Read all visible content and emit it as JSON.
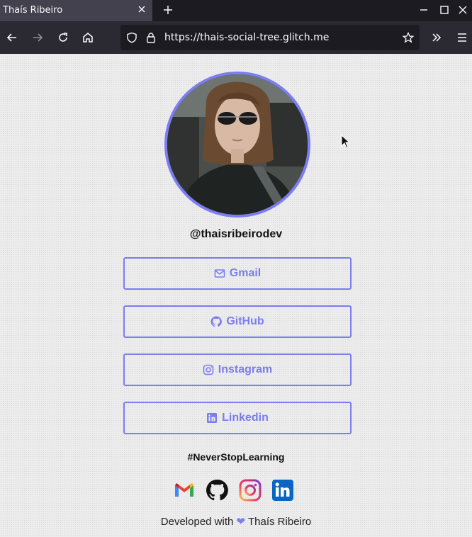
{
  "browser": {
    "tab_title": "Thaís Ribeiro",
    "url_text": "https://thais-social-tree.glitch.me"
  },
  "profile": {
    "username": "@thaisribeirodev"
  },
  "links": [
    {
      "label": "Gmail",
      "icon": "envelope-icon"
    },
    {
      "label": "GitHub",
      "icon": "github-icon"
    },
    {
      "label": "Instagram",
      "icon": "instagram-icon"
    },
    {
      "label": "Linkedin",
      "icon": "linkedin-icon"
    }
  ],
  "hashtag": "#NeverStopLearning",
  "footer": {
    "prefix": "Developed with",
    "heart": "❤",
    "author": "Thaís Ribeiro"
  },
  "colors": {
    "accent": "#7b7df0",
    "chrome_dark": "#1c1b22",
    "chrome_toolbar": "#2b2a33"
  }
}
